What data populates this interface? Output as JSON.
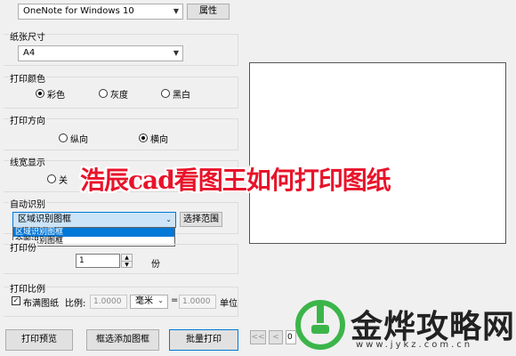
{
  "printer": {
    "selected": "OneNote for Windows 10",
    "properties_label": "属性"
  },
  "paper_size": {
    "label": "纸张尺寸",
    "selected": "A4"
  },
  "print_color": {
    "label": "打印颜色",
    "options": [
      "彩色",
      "灰度",
      "黑白"
    ],
    "selected": "彩色"
  },
  "print_direction": {
    "label": "打印方向",
    "options": [
      "纵向",
      "横向"
    ],
    "selected": "横向"
  },
  "line_width": {
    "label": "线宽显示",
    "partial_option": "关"
  },
  "auto_recognize": {
    "label": "自动识别",
    "selected": "区域识别图框",
    "dropdown_options": [
      "区域识别图框",
      "全图识别图框"
    ],
    "select_range_label": "选择范围"
  },
  "copies": {
    "label_partial": "打印份",
    "value": "1",
    "unit": "份"
  },
  "print_scale": {
    "label": "打印比例",
    "fit_checkbox_label": "布满图纸",
    "ratio_label": "比例:",
    "left_value": "1.0000",
    "unit_select": "毫米",
    "equals": "=",
    "right_value": "1.0000",
    "unit_label": "单位"
  },
  "bottom_buttons": {
    "preview": "打印预览",
    "add_frame": "框选添加图框",
    "batch_print": "批量打印"
  },
  "nav": {
    "first": "<<",
    "prev": "<",
    "page_partial": "0"
  },
  "overlay": {
    "title": "浩辰cad看图王如何打印图纸"
  },
  "watermark": {
    "brand": "金烨攻略网",
    "url": "www.jykz.com.cn"
  },
  "colors": {
    "overlay_red": "#e8132a",
    "selection_blue": "#0078d7",
    "logo_green": "#3bb54a"
  },
  "icons": [
    "chevron-down-icon",
    "spin-up-icon",
    "spin-down-icon",
    "checkbox-checked-icon",
    "power-plug-logo-icon"
  ]
}
